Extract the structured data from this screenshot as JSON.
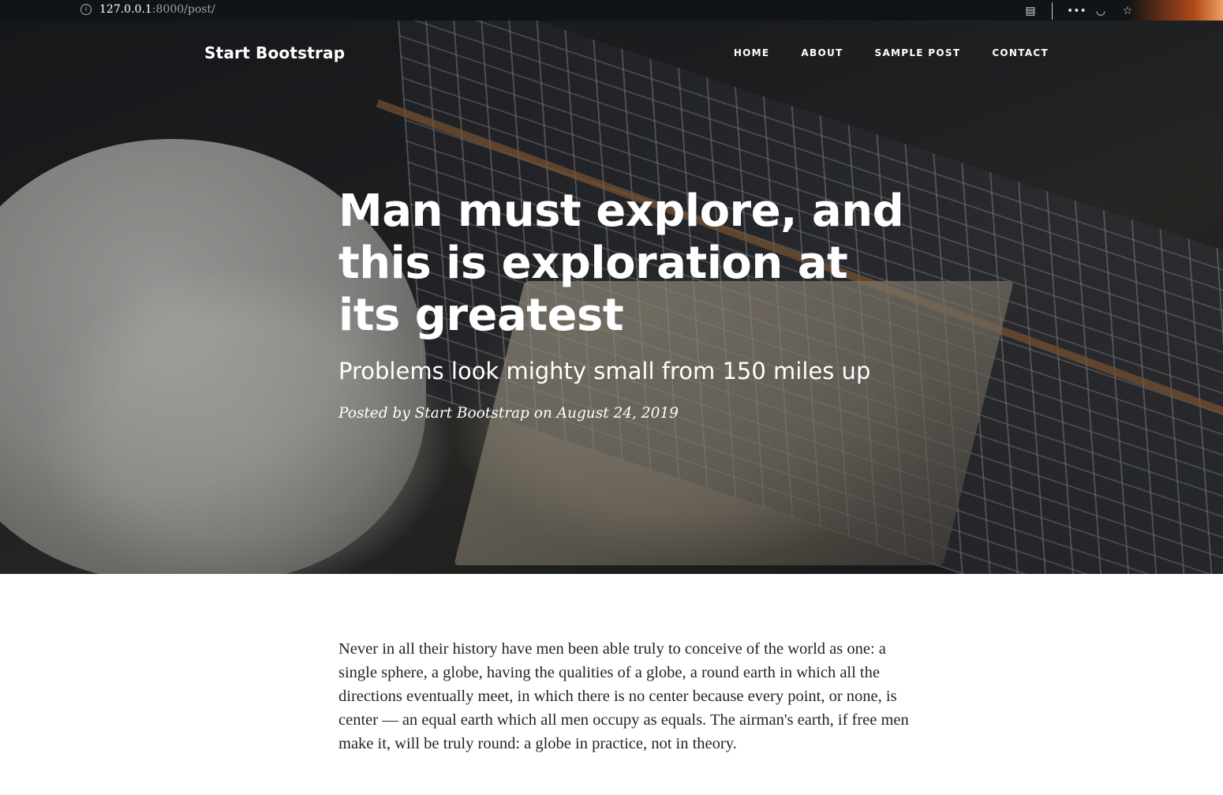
{
  "browser": {
    "host": "127.0.0.1",
    "path": ":8000/post/",
    "icons": [
      "info-icon",
      "reader-view-icon",
      "more-icon",
      "pocket-icon",
      "bookmark-star-icon"
    ]
  },
  "navbar": {
    "brand": "Start Bootstrap",
    "links": [
      "Home",
      "About",
      "Sample Post",
      "Contact"
    ]
  },
  "post": {
    "title": "Man must explore, and this is exploration at its greatest",
    "subtitle": "Problems look mighty small from 150 miles up",
    "meta": "Posted by Start Bootstrap on August 24, 2019",
    "body": "Never in all their history have men been able truly to conceive of the world as one: a single sphere, a globe, having the qualities of a globe, a round earth in which all the directions eventually meet, in which there is no center because every point, or none, is center — an equal earth which all men occupy as equals. The airman's earth, if free men make it, will be truly round: a globe in practice, not in theory."
  },
  "colors": {
    "browser_bar": "#0f1416",
    "hero_overlay": "#212529",
    "text": "#212529"
  }
}
